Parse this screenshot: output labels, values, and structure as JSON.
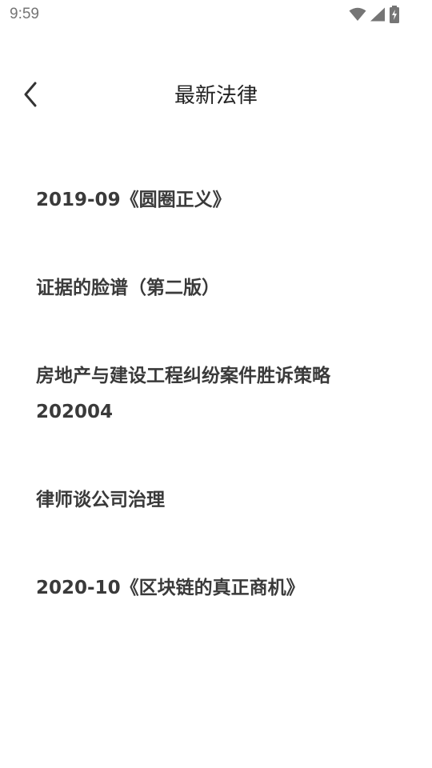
{
  "status_bar": {
    "time": "9:59",
    "icons": [
      "wifi-icon",
      "cellular-signal-icon",
      "battery-charging-icon"
    ]
  },
  "header": {
    "back_icon": "chevron-left-icon",
    "title": "最新法律"
  },
  "law_list": [
    {
      "label": "2019-09《圆圈正义》"
    },
    {
      "label": "证据的脸谱（第二版）"
    },
    {
      "label": "房地产与建设工程纠纷案件胜诉策略202004"
    },
    {
      "label": "律师谈公司治理"
    },
    {
      "label": "2020-10《区块链的真正商机》"
    }
  ],
  "colors": {
    "status_text": "#757575",
    "title_text": "#222222",
    "item_text": "#3a3a3a",
    "background": "#ffffff"
  }
}
